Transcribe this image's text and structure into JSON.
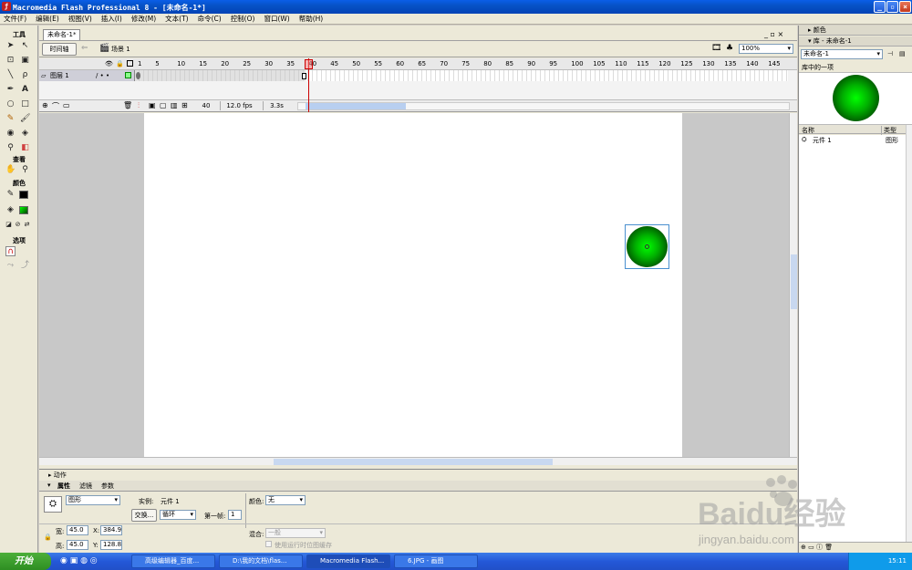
{
  "window": {
    "title": "Macromedia Flash Professional 8 - [未命名-1*]",
    "icon": "flash-app-icon"
  },
  "menu": [
    "文件(F)",
    "编辑(E)",
    "视图(V)",
    "插入(I)",
    "修改(M)",
    "文本(T)",
    "命令(C)",
    "控制(O)",
    "窗口(W)",
    "帮助(H)"
  ],
  "tools": {
    "title": "工具",
    "view_label": "查看",
    "color_label": "颜色",
    "options_label": "选项"
  },
  "document": {
    "tab": "未命名-1*",
    "timeline_button": "时间轴",
    "scene": "场景 1",
    "zoom": "100%",
    "layer_name": "图层 1",
    "frame_numbers": [
      "1",
      "5",
      "10",
      "15",
      "20",
      "25",
      "30",
      "35",
      "40",
      "45",
      "50",
      "55",
      "60",
      "65",
      "70",
      "75",
      "80",
      "85",
      "90",
      "95",
      "100",
      "105",
      "110",
      "115",
      "120",
      "125",
      "130",
      "135",
      "140",
      "145"
    ],
    "current_frame": "40",
    "fps": "12.0 fps",
    "time": "3.3s"
  },
  "properties": {
    "actions_label": "动作",
    "tabs": [
      "属性",
      "滤镜",
      "参数"
    ],
    "symbol_type": "图形",
    "instance_label": "实例:",
    "instance_name": "元件 1",
    "swap_button": "交换...",
    "loop_option": "循环",
    "first_frame_label": "第一帧:",
    "first_frame_value": "1",
    "color_label": "颜色:",
    "color_value": "无",
    "width_label": "宽:",
    "width": "45.0",
    "height_label": "高:",
    "height": "45.0",
    "x_label": "X:",
    "x": "384.9",
    "y_label": "Y:",
    "y": "128.8",
    "blend_label": "混合:",
    "blend_value": "一般",
    "cache_label": "使用运行时位图缓存"
  },
  "right_panel": {
    "color_title": "颜色",
    "library_title": "库 - 未命名-1",
    "library_select": "未命名-1",
    "library_count": "库中的一项",
    "col_name": "名称",
    "col_type": "类型",
    "item_name": "元件 1",
    "item_type": "图形"
  },
  "taskbar": {
    "start": "开始",
    "items": [
      "高级编辑器_百度...",
      "D:\\我的文档\\flas...",
      "Macromedia Flash...",
      "6.JPG - 画图"
    ],
    "clock": "15:11"
  },
  "watermark": {
    "brand": "Baidu经验",
    "url": "jingyan.baidu.com"
  },
  "colors": {
    "title_bar": "#0a5ee8",
    "accent_green": "#00ff00",
    "playhead": "#cc0000"
  }
}
